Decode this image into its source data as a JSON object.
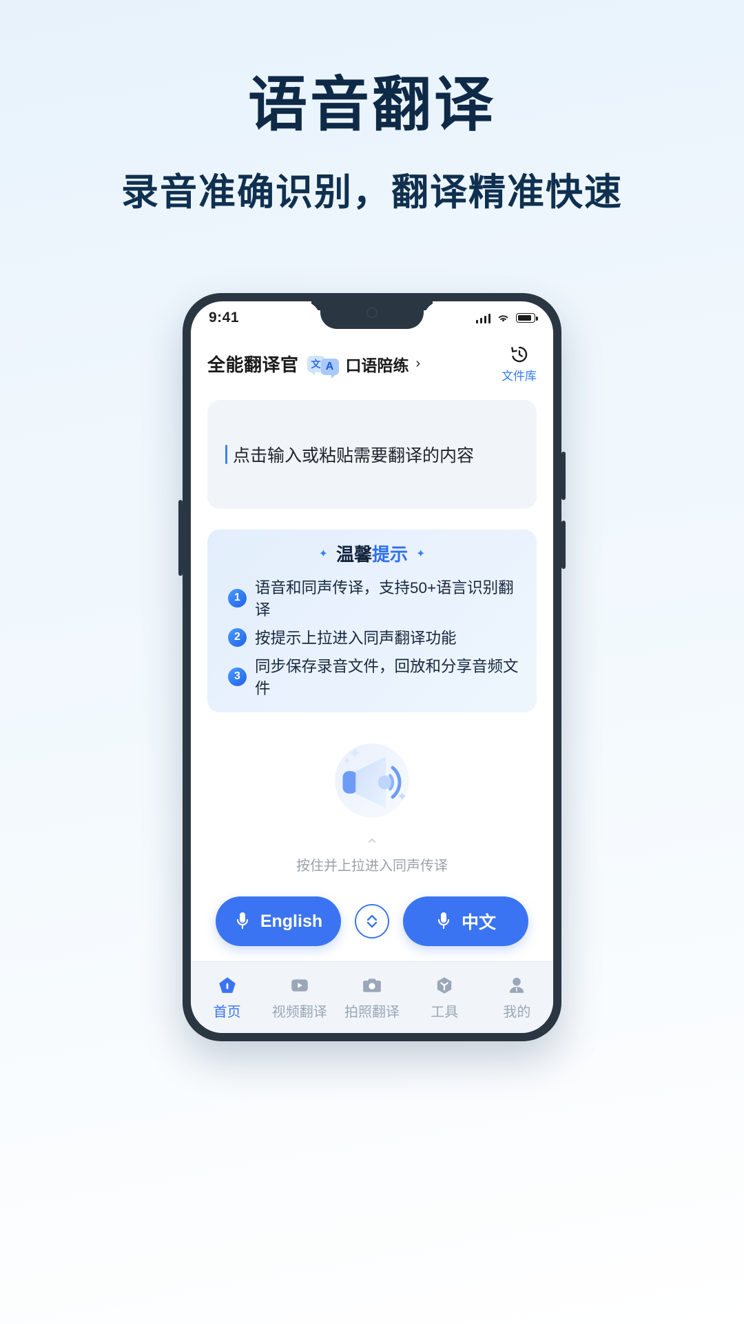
{
  "poster": {
    "title": "语音翻译",
    "subtitle": "录音准确识别，翻译精准快速"
  },
  "status_bar": {
    "time": "9:41",
    "signal_icon": "cellular-signal-icon",
    "wifi_icon": "wifi-icon",
    "battery_icon": "battery-icon"
  },
  "app_header": {
    "brand": "全能翻译官",
    "badge_cn": "文",
    "badge_en": "A",
    "chip_label": "口语陪练",
    "chip_arrow": "›",
    "file_library_label": "文件库",
    "file_library_icon": "history-clock-icon"
  },
  "input_card": {
    "placeholder": "点击输入或粘贴需要翻译的内容"
  },
  "tips": {
    "title_part1": "温馨",
    "title_part2": "提示",
    "sparkle": "✦",
    "items": [
      {
        "num": "1",
        "text": "语音和同声传译，支持50+语言识别翻译"
      },
      {
        "num": "2",
        "text": "按提示上拉进入同声翻译功能"
      },
      {
        "num": "3",
        "text": "同步保存录音文件，回放和分享音频文件"
      }
    ]
  },
  "illustration": {
    "icon": "speaker-sound-icon"
  },
  "pull_hint": {
    "chevron": "⌃",
    "text": "按住并上拉进入同声传译"
  },
  "mic_controls": {
    "left_label": "English",
    "right_label": "中文",
    "mic_icon": "microphone-icon",
    "swap_icon": "swap-vertical-icon"
  },
  "tabbar": {
    "items": [
      {
        "label": "首页",
        "icon": "home-icon",
        "active": true
      },
      {
        "label": "视频翻译",
        "icon": "video-icon",
        "active": false
      },
      {
        "label": "拍照翻译",
        "icon": "camera-icon",
        "active": false
      },
      {
        "label": "工具",
        "icon": "tools-cube-icon",
        "active": false
      },
      {
        "label": "我的",
        "icon": "person-icon",
        "active": false
      }
    ]
  },
  "colors": {
    "accent_blue": "#3b74f2",
    "title_navy": "#0f2a47",
    "tab_inactive": "#9aa7b8"
  }
}
